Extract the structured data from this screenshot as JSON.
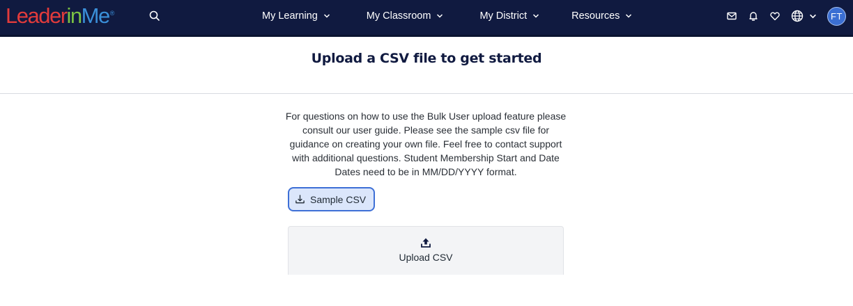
{
  "brand": {
    "logo_leader": "Leader",
    "logo_in": "in",
    "logo_me": "Me",
    "logo_mark": "®",
    "colors": {
      "leader": "#e23b3b",
      "in": "#7ac143",
      "me": "#3a8fd9",
      "navbar_bg": "#101a40"
    }
  },
  "nav": {
    "search_icon": "search-icon",
    "items": [
      {
        "label": "My Learning"
      },
      {
        "label": "My Classroom"
      },
      {
        "label": "My District"
      },
      {
        "label": "Resources"
      }
    ],
    "right_icons": [
      "mail-icon",
      "bell-icon",
      "heart-icon",
      "globe-icon"
    ],
    "avatar_initials": "FT"
  },
  "page": {
    "title": "Upload a CSV file to get started",
    "intro": "For questions on how to use the Bulk User upload feature please consult our user guide. Please see the sample csv file for guidance on creating your own file. Feel free to contact support with additional questions. Student Membership Start and Date Dates need to be in MM/DD/YYYY format.",
    "sample_button_label": "Sample CSV",
    "upload_label": "Upload CSV",
    "accent_color": "#3d6fd6"
  }
}
